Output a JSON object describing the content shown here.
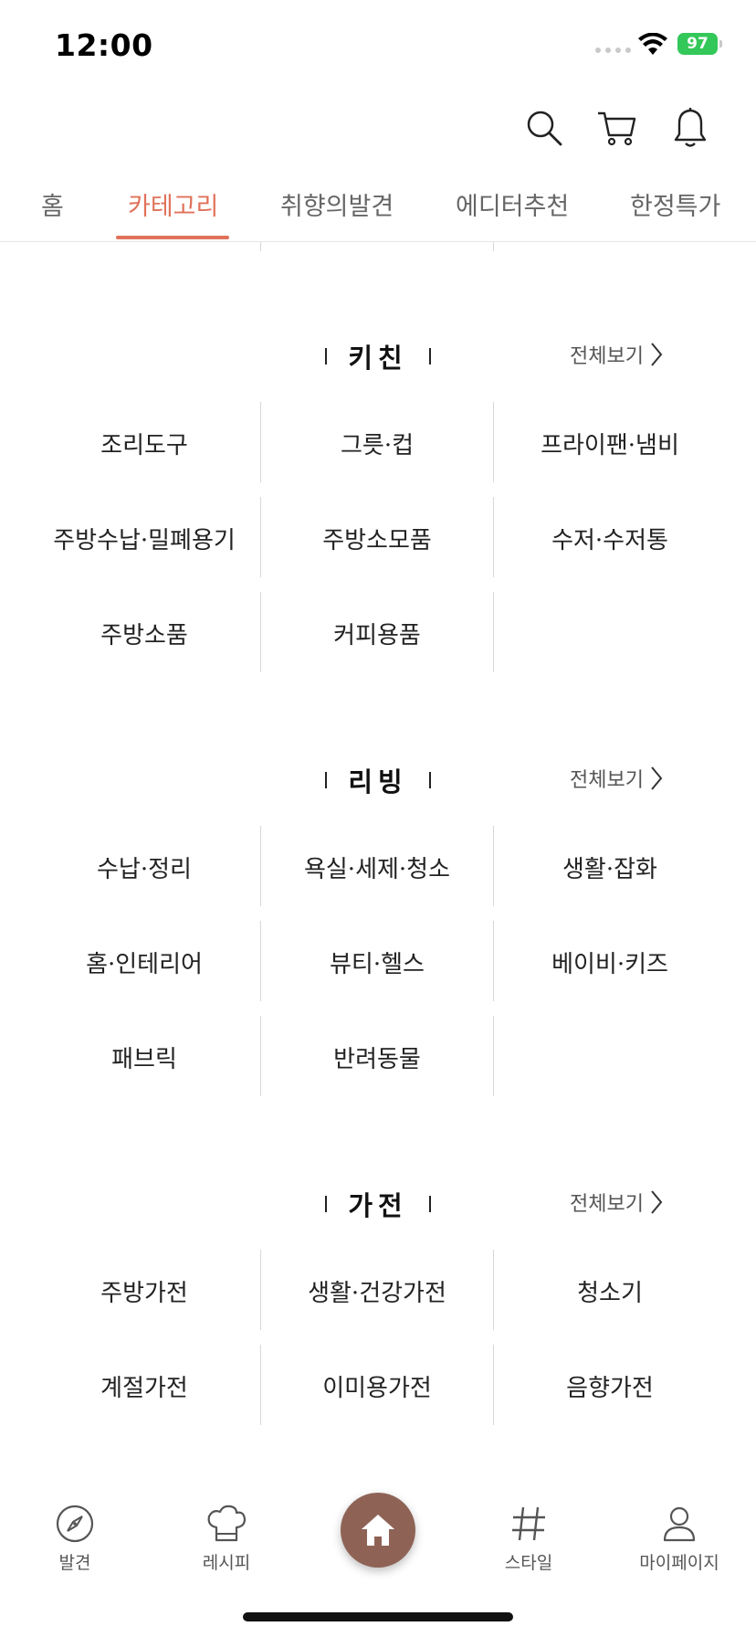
{
  "status": {
    "time": "12:00",
    "battery": "97"
  },
  "tabs": [
    {
      "label": "홈"
    },
    {
      "label": "카테고리"
    },
    {
      "label": "취향의발견"
    },
    {
      "label": "에디터추천"
    },
    {
      "label": "한정특가"
    }
  ],
  "active_tab": "카테고리",
  "view_all_label": "전체보기",
  "sections": [
    {
      "title": "키친",
      "items": [
        "조리도구",
        "그릇·컵",
        "프라이팬·냄비",
        "주방수납·밀폐용기",
        "주방소모품",
        "수저·수저통",
        "주방소품",
        "커피용품"
      ]
    },
    {
      "title": "리빙",
      "items": [
        "수납·정리",
        "욕실·세제·청소",
        "생활·잡화",
        "홈·인테리어",
        "뷰티·헬스",
        "베이비·키즈",
        "패브릭",
        "반려동물"
      ]
    },
    {
      "title": "가전",
      "items": [
        "주방가전",
        "생활·건강가전",
        "청소기",
        "계절가전",
        "이미용가전",
        "음향가전"
      ]
    }
  ],
  "bottom_nav": [
    {
      "label": "발견",
      "icon": "compass-icon"
    },
    {
      "label": "레시피",
      "icon": "chef-hat-icon"
    },
    {
      "label": "",
      "icon": "home-icon"
    },
    {
      "label": "스타일",
      "icon": "hashtag-icon"
    },
    {
      "label": "마이페이지",
      "icon": "person-icon"
    }
  ],
  "colors": {
    "accent": "#e0725a",
    "home_button": "#8e6356",
    "battery": "#34c759"
  }
}
